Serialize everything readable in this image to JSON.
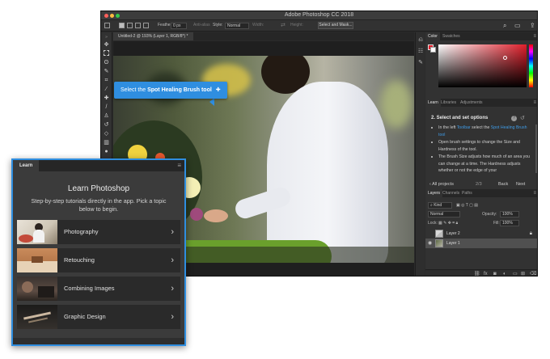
{
  "window": {
    "title": "Adobe Photoshop CC 2018"
  },
  "options_bar": {
    "feather_label": "Feather:",
    "feather_value": "0 px",
    "antialias_label": "Anti-alias",
    "style_label": "Style:",
    "style_value": "Normal",
    "width_label": "Width:",
    "height_label": "Height:",
    "select_mask_label": "Select and Mask..."
  },
  "document": {
    "tab_label": "Untitled-2 @ 193% (Layer 1, RGB/8*) *"
  },
  "tooltip": {
    "prefix": "Select the ",
    "tool_name": "Spot Healing Brush tool"
  },
  "panels": {
    "color_tabs": [
      "Color",
      "Swatches"
    ],
    "learn_tabs": [
      "Learn",
      "Libraries",
      "Adjustments"
    ],
    "layers_tabs": [
      "Layers",
      "Channels",
      "Paths"
    ],
    "colors": {
      "foreground": "#e01e2a",
      "background": "#ffffff",
      "accent": "#2f8ee0"
    }
  },
  "learn_panel": {
    "step_title": "2.  Select and set options",
    "items": [
      {
        "before": "In the left ",
        "hl1": "Toolbar",
        "middle": " select the ",
        "hl2": "Spot Healing Brush tool",
        "after": ""
      },
      {
        "before": "Open brush settings to change the Size and Hardness of the tool.",
        "hl1": "",
        "middle": "",
        "hl2": "",
        "after": ""
      },
      {
        "before": "The Brush Size adjusts how much of an area you can change at a time. The Hardness adjusts whether or not the edge of your",
        "hl1": "",
        "middle": "",
        "hl2": "",
        "after": ""
      }
    ],
    "footer": {
      "all_projects": "All projects",
      "progress": "2/3",
      "back": "Back",
      "next": "Next"
    }
  },
  "layers_panel": {
    "kind_label": "Kind",
    "blend_mode": "Normal",
    "opacity_label": "Opacity:",
    "opacity_value": "100%",
    "lock_label": "Lock:",
    "fill_label": "Fill:",
    "fill_value": "100%",
    "layers": [
      {
        "name": "Layer 2"
      },
      {
        "name": "Layer 1"
      }
    ]
  },
  "learn_overlay": {
    "tab_label": "Learn",
    "title": "Learn Photoshop",
    "subtitle": "Step-by-step tutorials directly in the app. Pick a topic below to begin.",
    "topics": [
      {
        "label": "Photography"
      },
      {
        "label": "Retouching"
      },
      {
        "label": "Combining Images"
      },
      {
        "label": "Graphic Design"
      }
    ]
  }
}
